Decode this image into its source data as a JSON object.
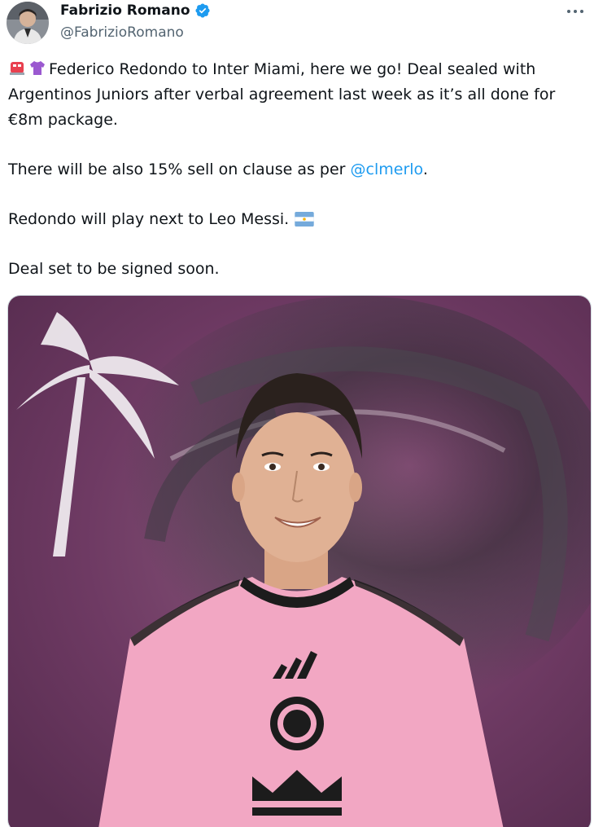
{
  "author": {
    "display_name": "Fabrizio Romano",
    "handle": "@FabrizioRomano",
    "verified": true,
    "avatar_icon": "profile-photo"
  },
  "menu": {
    "more_icon": "more-options-icon"
  },
  "tweet": {
    "line1_emojis": [
      "police-light-emoji",
      "purple-shirt-emoji"
    ],
    "line1_text": "Federico Redondo to Inter Miami, here we go! Deal sealed with Argentinos Juniors after verbal agreement last week as it’s all done for €8m package.",
    "line2_prefix": "There will be also 15% sell on clause as per ",
    "line2_mention": "@clmerlo",
    "line2_suffix": ".",
    "line3_text": "Redondo will play next to Leo Messi.",
    "line3_emoji": "argentina-flag-emoji",
    "line4_text": "Deal set to be signed soon."
  },
  "media": {
    "description_icon": "player-photo",
    "colors": {
      "background": "#6e3a63",
      "shirt": "#f2a7c3",
      "accent": "#1d9bf0",
      "text_secondary": "#536471"
    }
  }
}
